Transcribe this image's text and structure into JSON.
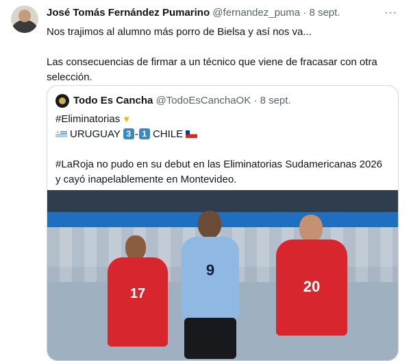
{
  "tweet": {
    "author_name": "José Tomás Fernández Pumarino",
    "handle": "@fernandez_puma",
    "separator": " · ",
    "date": "8 sept.",
    "more": "···",
    "text_line1": "Nos trajimos al alumno más porro de Bielsa y así nos va...",
    "text_line2": "Las consecuencias de firmar a un técnico que viene de fracasar con otra selección."
  },
  "quote": {
    "author_name": "Todo Es Cancha",
    "handle": "@TodoEsCanchaOK",
    "separator": " · ",
    "date": "8 sept.",
    "hashtag_line": "#Eliminatorias",
    "team1": "URUGUAY",
    "score1": "3",
    "dash": "-",
    "score2": "1",
    "team2": "CHILE",
    "body": "#LaRoja no pudo en su debut en las Eliminatorias Sudamericanas 2026 y cayó inapelablemente en Montevideo.",
    "photo": {
      "player_uy_number": "9",
      "player_cl1_number": "17",
      "player_cl2_number": "20"
    }
  },
  "icons": {
    "pointing_down": "pointing-down-icon",
    "flag_uruguay": "uruguay-flag-icon",
    "flag_chile": "chile-flag-icon",
    "more": "more-icon"
  }
}
